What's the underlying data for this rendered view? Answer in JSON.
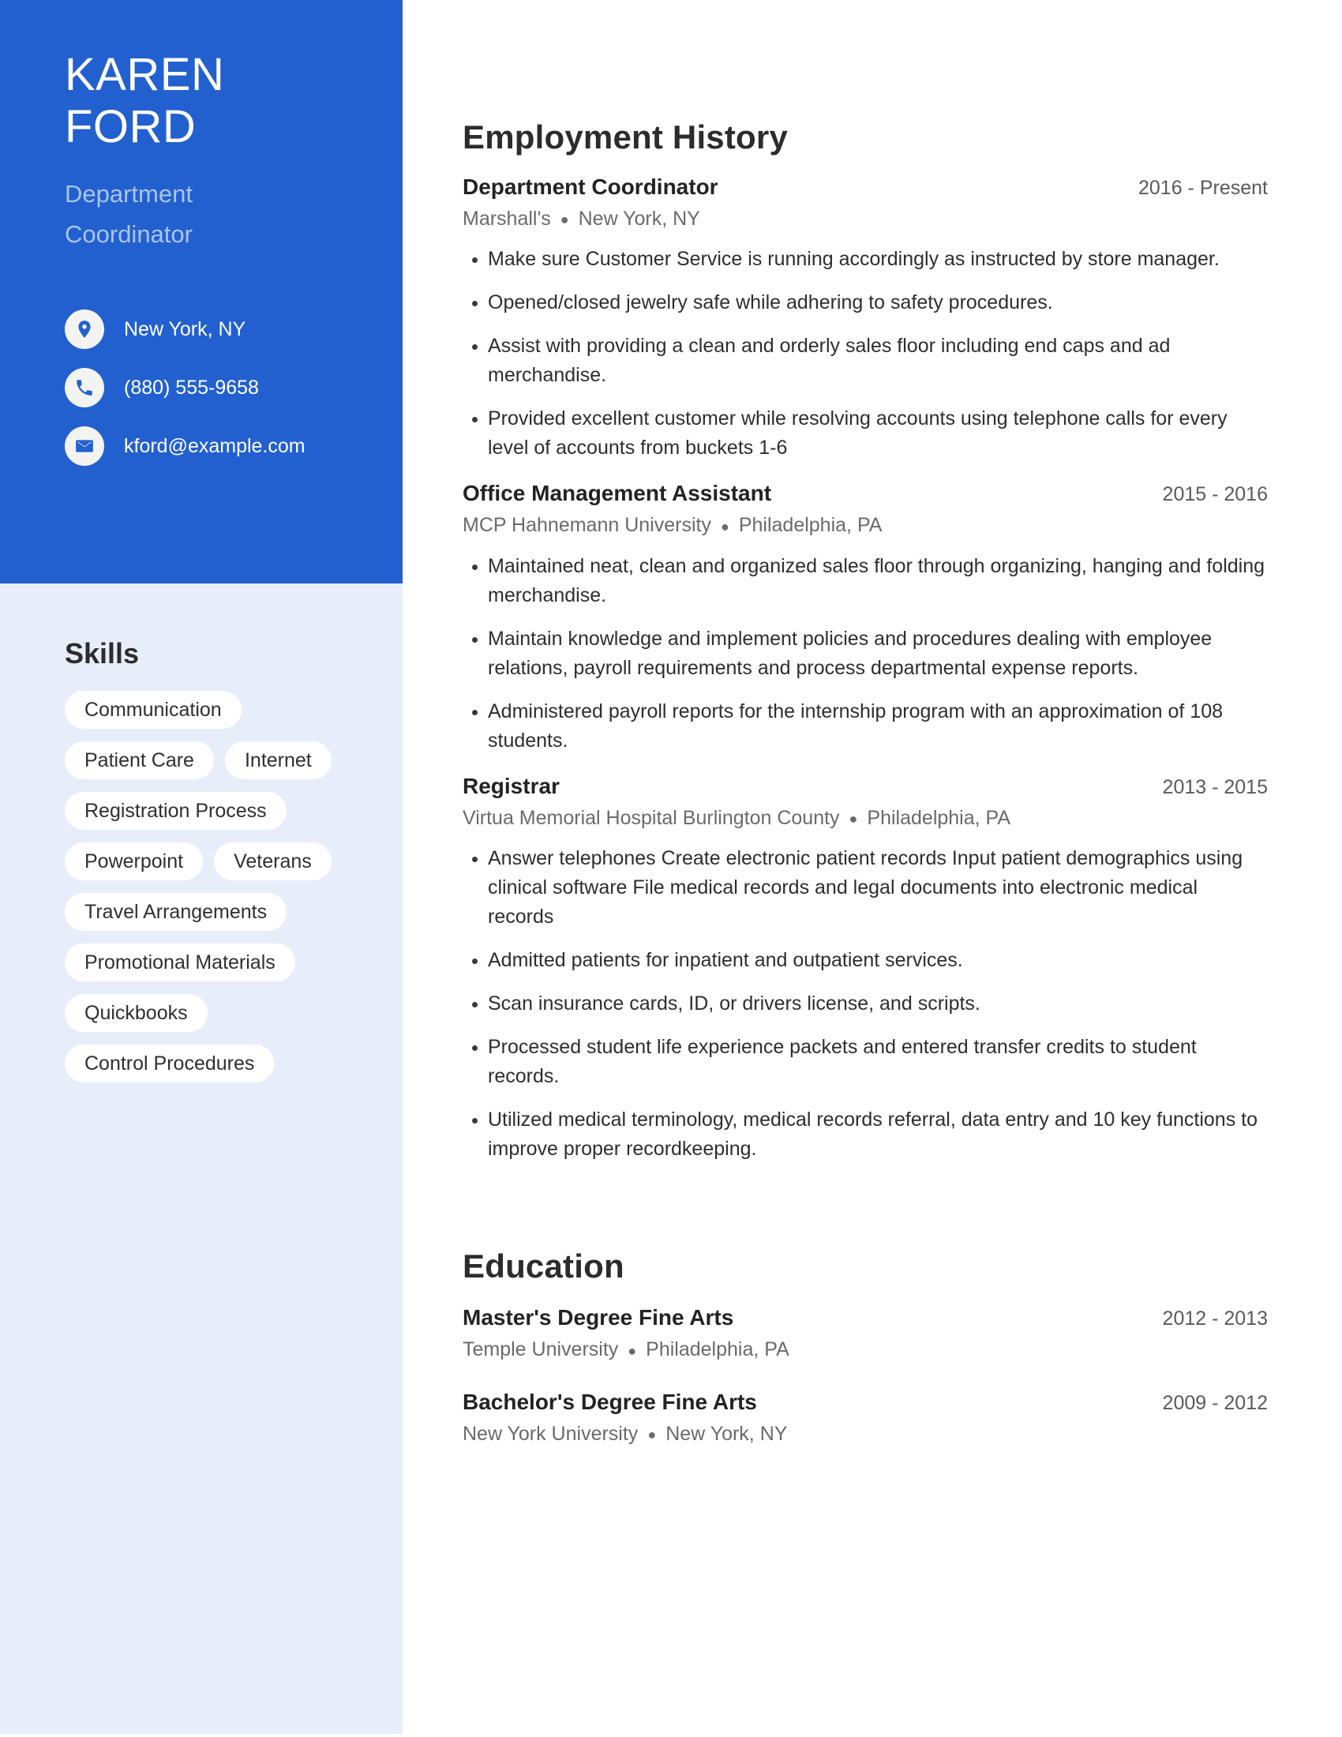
{
  "colors": {
    "accent": "#2360cf",
    "sidebar_bg": "#e8eef9",
    "role_text": "#a9c4ee",
    "pill_bg": "#ffffff",
    "body_text": "#2e2e2e",
    "muted_text": "#6a6a6a"
  },
  "header": {
    "name_lines": [
      "KAREN",
      "FORD"
    ],
    "role_lines": [
      "Department",
      "Coordinator"
    ],
    "contacts": [
      {
        "icon": "location-pin-icon",
        "text": "New York, NY"
      },
      {
        "icon": "phone-icon",
        "text": "(880) 555-9658"
      },
      {
        "icon": "envelope-icon",
        "text": "kford@example.com"
      }
    ]
  },
  "skills": {
    "title": "Skills",
    "rows": [
      [
        "Communication"
      ],
      [
        "Patient Care",
        "Internet"
      ],
      [
        "Registration Process"
      ],
      [
        "Powerpoint",
        "Veterans"
      ],
      [
        "Travel Arrangements"
      ],
      [
        "Promotional Materials"
      ],
      [
        "Quickbooks"
      ],
      [
        "Control Procedures"
      ]
    ]
  },
  "employment": {
    "title": "Employment History",
    "entries": [
      {
        "title": "Department Coordinator",
        "dates": "2016 - Present",
        "company": "Marshall's",
        "location": "New York, NY",
        "bullets": [
          "Make sure Customer Service is running accordingly as instructed by store manager.",
          "Opened/closed jewelry safe while adhering to safety procedures.",
          "Assist with providing a clean and orderly sales floor including end caps and ad merchandise.",
          "Provided excellent customer while resolving accounts using telephone calls for every level of accounts from buckets 1-6"
        ]
      },
      {
        "title": "Office Management Assistant",
        "dates": "2015 - 2016",
        "company": "MCP Hahnemann University",
        "location": "Philadelphia, PA",
        "bullets": [
          "Maintained neat, clean and organized sales floor through organizing, hanging and folding merchandise.",
          "Maintain knowledge and implement policies and procedures dealing with employee relations, payroll requirements and process departmental expense reports.",
          "Administered payroll reports for the internship program with an approximation of 108 students."
        ]
      },
      {
        "title": "Registrar",
        "dates": "2013 - 2015",
        "company": "Virtua Memorial Hospital Burlington County",
        "location": "Philadelphia, PA",
        "bullets": [
          "Answer telephones Create electronic patient records Input patient demographics using clinical software File medical records and legal documents into electronic medical records",
          "Admitted patients for inpatient and outpatient services.",
          "Scan insurance cards, ID, or drivers license, and scripts.",
          "Processed student life experience packets and entered transfer credits to student records.",
          "Utilized medical terminology, medical records referral, data entry and 10 key functions to improve proper recordkeeping."
        ]
      }
    ]
  },
  "education": {
    "title": "Education",
    "entries": [
      {
        "title": "Master's Degree Fine Arts",
        "dates": "2012 - 2013",
        "school": "Temple University",
        "location": "Philadelphia, PA"
      },
      {
        "title": "Bachelor's Degree Fine Arts",
        "dates": "2009 - 2012",
        "school": "New York University",
        "location": "New York, NY"
      }
    ]
  }
}
